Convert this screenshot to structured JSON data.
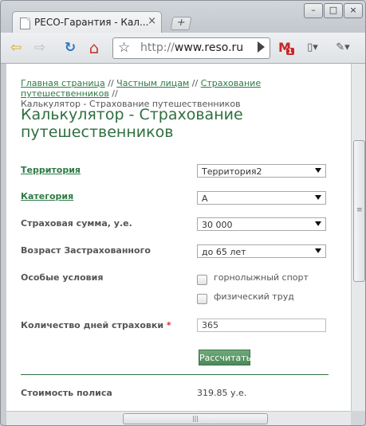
{
  "tab": {
    "title": "РЕСО-Гарантия - Кал...",
    "close": "×",
    "new_tab": "+"
  },
  "window_controls": {
    "minimize": "–",
    "maximize": "□",
    "close": "×"
  },
  "toolbar": {
    "back": "⇦",
    "forward": "⇨",
    "reload": "↻",
    "home": "⌂",
    "url_proto": "http://",
    "url_host": "www.reso.ru",
    "mail": "M",
    "mail_badge": "1",
    "page_menu": "▯▾",
    "wrench_menu": "✎▾"
  },
  "breadcrumb": {
    "items": [
      "Главная страница",
      "Частным лицам",
      "Страхование путешественников"
    ],
    "separator": " // ",
    "current": "Калькулятор - Страхование путешественников"
  },
  "page_title": "Калькулятор - Страхование путешественников",
  "form": {
    "territory_label": "Территория",
    "territory_value": "Территория2",
    "category_label": "Категория",
    "category_value": "A",
    "sum_label": "Страховая сумма, у.е.",
    "sum_value": "30 000",
    "age_label": "Возраст Застрахованного",
    "age_value": "до 65 лет",
    "conditions_label": "Особые условия",
    "conditions": [
      "горнолыжный спорт",
      "физический труд"
    ],
    "days_label": "Количество дней страховки",
    "days_required_mark": "*",
    "days_value": "365",
    "submit_label": "Рассчитать"
  },
  "result": {
    "label": "Стоимость полиса",
    "value": "319.85 у.е."
  },
  "colors": {
    "accent_green": "#2c7a45",
    "button_green": "#5a9a66",
    "chrome_gray": "#c9cdd2"
  }
}
